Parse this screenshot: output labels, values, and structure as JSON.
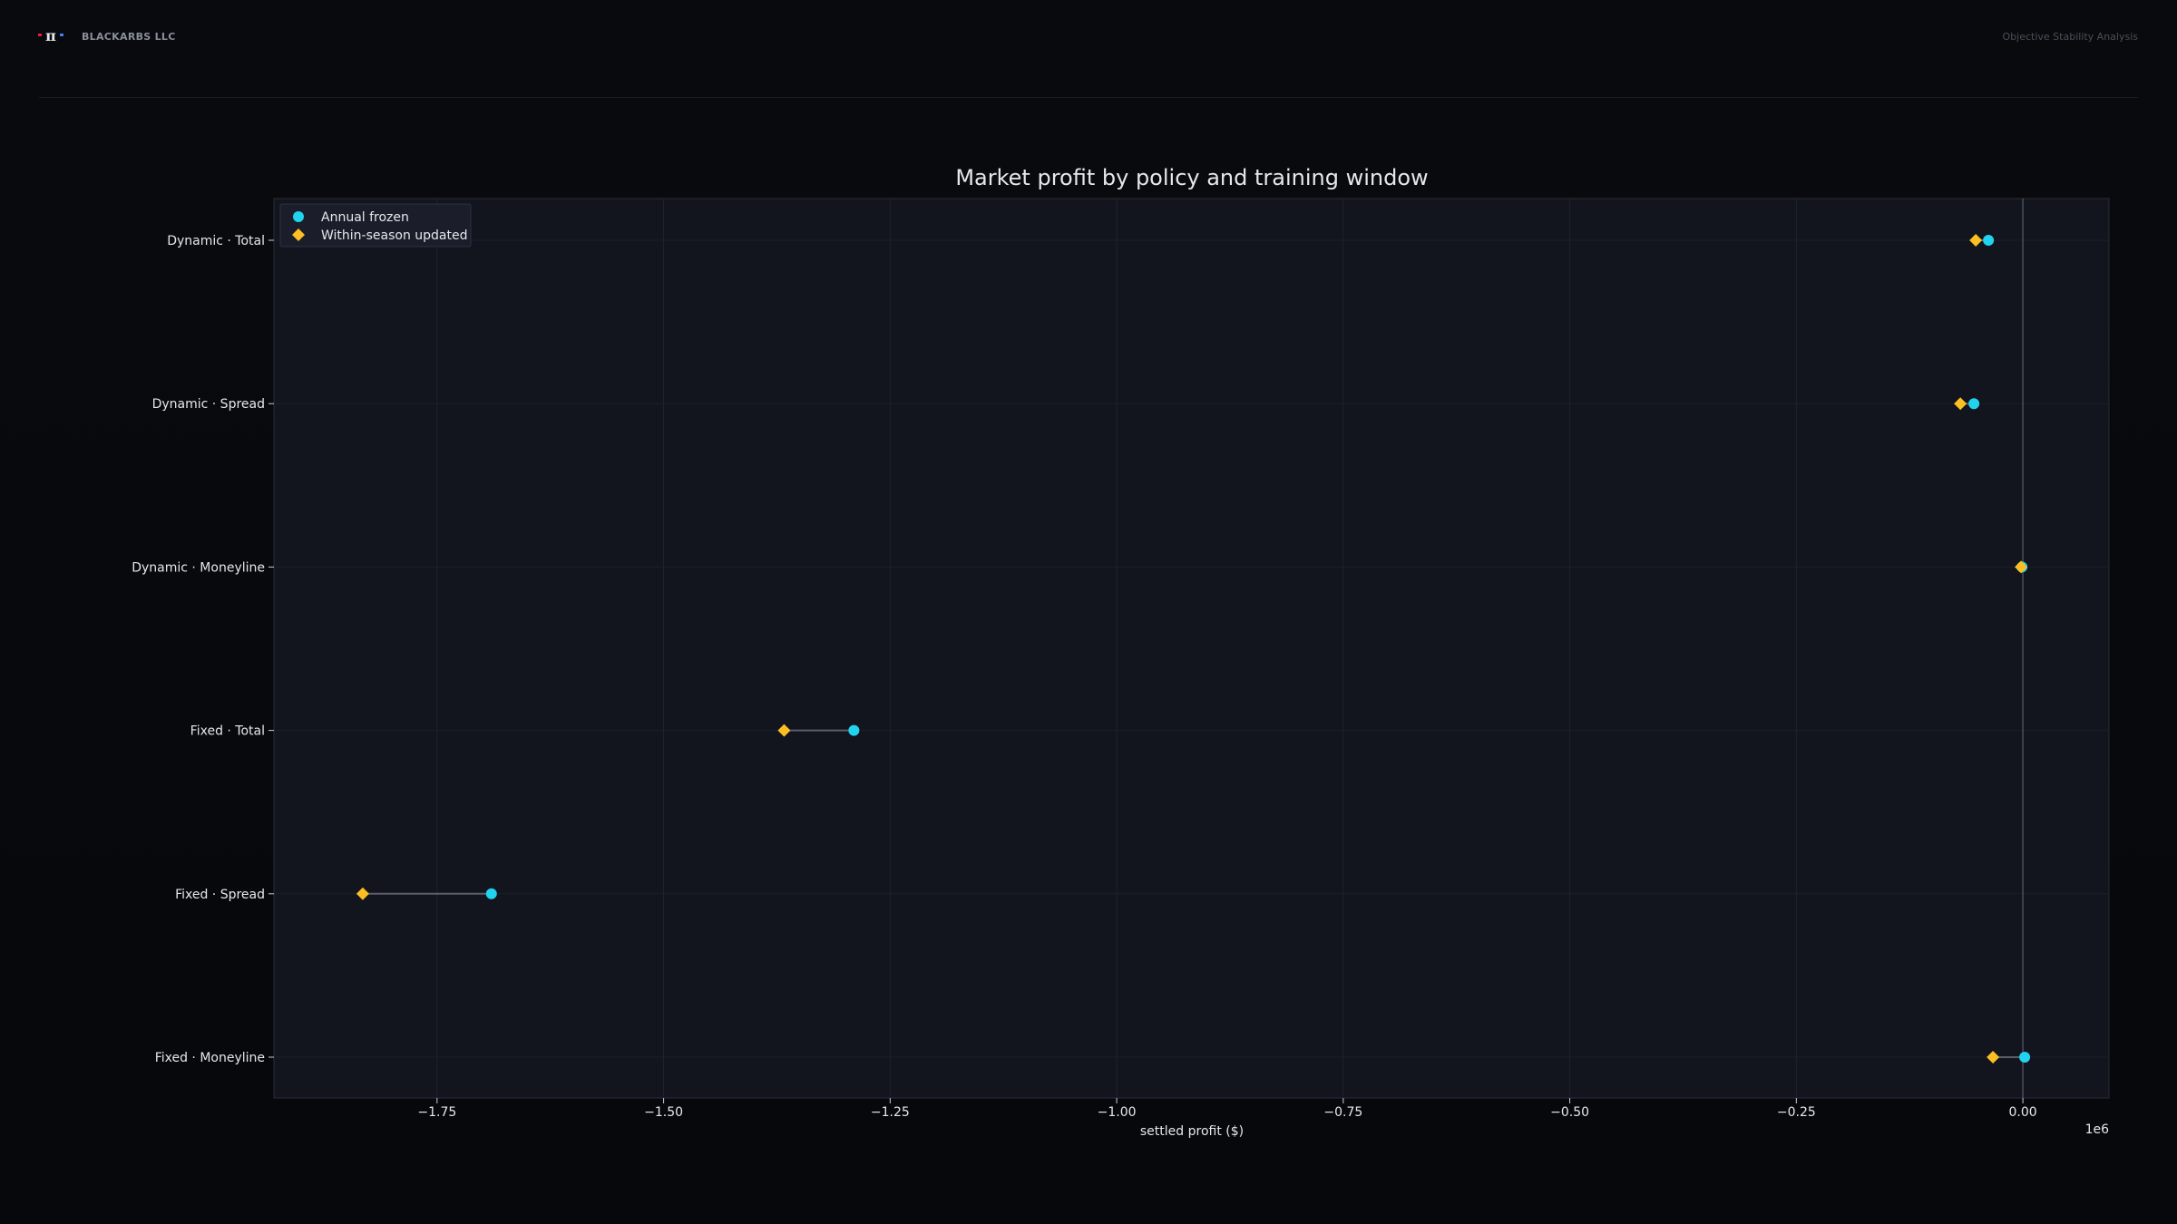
{
  "header": {
    "logo_icon": "pi-logo-icon",
    "brand_name": "BLACKARBS LLC",
    "report_name": "Objective Stability Analysis"
  },
  "colors": {
    "background": "#07090d",
    "plot_background": "#12141e",
    "annual_frozen": "#22d3ee",
    "within_season_updated": "#fbbf24",
    "connector": "#5a5f6a",
    "text": "#e5e7eb"
  },
  "chart_data": {
    "type": "dumbbell",
    "title": "Market profit by policy and training window",
    "xlabel": "settled profit ($)",
    "ylabel": "",
    "x_offset_label": "1e6",
    "xlim": [
      -1.93,
      0.095
    ],
    "x_ticks": [
      -1.75,
      -1.5,
      -1.25,
      -1.0,
      -0.75,
      -0.5,
      -0.25,
      0.0
    ],
    "x_tick_labels": [
      "−1.75",
      "−1.50",
      "−1.25",
      "−1.00",
      "−0.75",
      "−0.50",
      "−0.25",
      "0.00"
    ],
    "grid": true,
    "zero_line": true,
    "legend_position": "top-left",
    "categories": [
      "Dynamic · Total",
      "Dynamic · Spread",
      "Dynamic · Moneyline",
      "Fixed · Total",
      "Fixed · Spread",
      "Fixed · Moneyline"
    ],
    "series": [
      {
        "name": "Annual frozen",
        "marker": "circle",
        "color": "#22d3ee",
        "values": [
          -0.038,
          -0.054,
          -0.001,
          -1.29,
          -1.69,
          0.002
        ]
      },
      {
        "name": "Within-season updated",
        "marker": "diamond",
        "color": "#fbbf24",
        "values": [
          -0.052,
          -0.069,
          -0.002,
          -1.367,
          -1.832,
          -0.033
        ]
      }
    ]
  }
}
